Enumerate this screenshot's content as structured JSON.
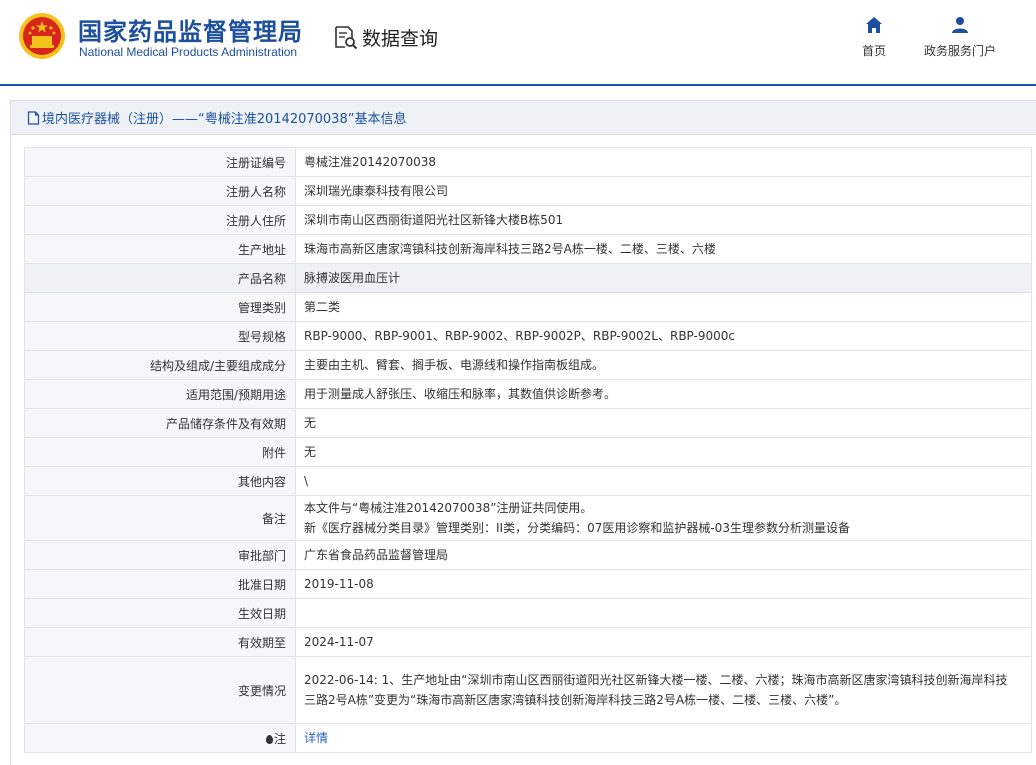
{
  "header": {
    "title": "国家药品监督管理局",
    "subtitle": "National Medical Products Administration",
    "query_label": "数据查询",
    "nav": [
      {
        "label": "首页",
        "icon": "home-icon"
      },
      {
        "label": "政务服务门户",
        "icon": "user-icon"
      }
    ]
  },
  "colors": {
    "brand": "#1c4f9c",
    "link": "#2b63c2",
    "emblem_red": "#d8261c",
    "emblem_gold": "#f4c21a"
  },
  "panel": {
    "title": "境内医疗器械（注册）——“粤械注准20142070038”基本信息"
  },
  "rows": [
    {
      "label": "注册证编号",
      "value": "粤械注准20142070038"
    },
    {
      "label": "注册人名称",
      "value": "深圳瑞光康泰科技有限公司"
    },
    {
      "label": "注册人住所",
      "value": "深圳市南山区西丽街道阳光社区新锋大楼B栋501"
    },
    {
      "label": "生产地址",
      "value": "珠海市高新区唐家湾镇科技创新海岸科技三路2号A栋一楼、二楼、三楼、六楼"
    },
    {
      "label": "产品名称",
      "value": "脉搏波医用血压计"
    },
    {
      "label": "管理类别",
      "value": "第二类"
    },
    {
      "label": "型号规格",
      "value": "RBP-9000、RBP-9001、RBP-9002、RBP-9002P、RBP-9002L、RBP-9000c"
    },
    {
      "label": "结构及组成/主要组成成分",
      "value": "主要由主机、臂套、搁手板、电源线和操作指南板组成。"
    },
    {
      "label": "适用范围/预期用途",
      "value": "用于测量成人舒张压、收缩压和脉率，其数值供诊断参考。"
    },
    {
      "label": "产品储存条件及有效期",
      "value": "无"
    },
    {
      "label": "附件",
      "value": "无"
    },
    {
      "label": "其他内容",
      "value": "\\"
    },
    {
      "label": "备注",
      "value_line1": "本文件与“粤械注准20142070038”注册证共同使用。",
      "value_line2": "新《医疗器械分类目录》管理类别：II类，分类编码：07医用诊察和监护器械-03生理参数分析测量设备"
    },
    {
      "label": "审批部门",
      "value": "广东省食品药品监督管理局"
    },
    {
      "label": "批准日期",
      "value": "2019-11-08"
    },
    {
      "label": "生效日期",
      "value": ""
    },
    {
      "label": "有效期至",
      "value": "2024-11-07"
    },
    {
      "label": "变更情况",
      "value": "2022-06-14: 1、生产地址由“深圳市南山区西丽街道阳光社区新锋大楼一楼、二楼、六楼；珠海市高新区唐家湾镇科技创新海岸科技三路2号A栋”变更为“珠海市高新区唐家湾镇科技创新海岸科技三路2号A栋一楼、二楼、三楼、六楼”。"
    },
    {
      "label": "注",
      "value": "详情",
      "icon": "note-icon"
    }
  ]
}
